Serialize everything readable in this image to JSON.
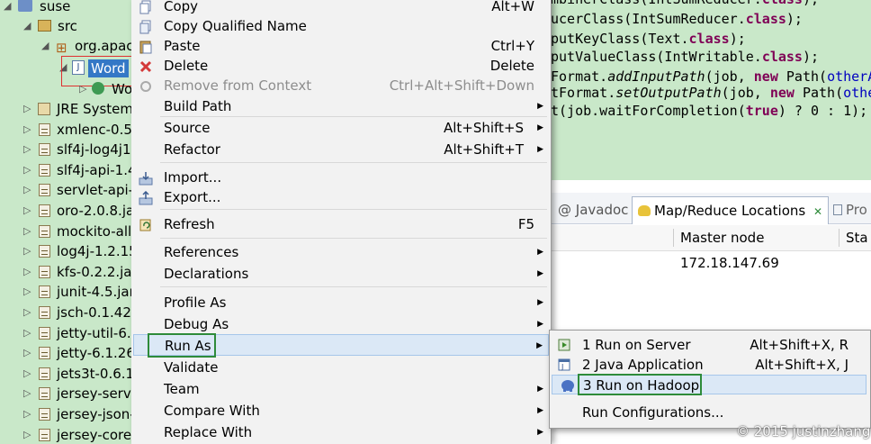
{
  "explorer": {
    "project": "suse",
    "src": "src",
    "package": "org.apac",
    "selected_file": "Word",
    "child_class": "Wo",
    "libraries": [
      "JRE System",
      "xmlenc-0.5.",
      "slf4j-log4j1",
      "slf4j-api-1.4",
      "servlet-api-",
      "oro-2.0.8.ja",
      "mockito-all",
      "log4j-1.2.15",
      "kfs-0.2.2.jar",
      "junit-4.5.jar",
      "jsch-0.1.42.",
      "jetty-util-6.",
      "jetty-6.1.26",
      "jets3t-0.6.1",
      "jersey-serve",
      "jersey-json-",
      "jersey-core"
    ]
  },
  "editor": {
    "lines": [
      {
        "pre": "mbinerClass(IntSumReducer.",
        "kw": "class",
        "post": ");"
      },
      {
        "pre": "ucerClass(IntSumReducer.",
        "kw": "class",
        "post": ");"
      },
      {
        "pre": "putKeyClass(Text.",
        "kw": "class",
        "post": ");"
      },
      {
        "pre": "putValueClass(IntWritable.",
        "kw": "class",
        "post": ");"
      },
      {
        "pre": "Format.",
        "it": "addInputPath",
        "mid": "(job, ",
        "kw2": "new",
        "post": " Path(",
        "fld": "otherA"
      },
      {
        "pre": "tFormat.",
        "it": "setOutputPath",
        "mid": "(job, ",
        "kw2": "new",
        "post": " Path(",
        "fld": "othe"
      },
      {
        "pre": "t(job.waitForCompletion(",
        "kw": "true",
        "post": ") ? 0 : 1);"
      }
    ]
  },
  "views": {
    "tab_javadoc": "@ Javadoc",
    "tab_mapreduce": "Map/Reduce Locations",
    "tab_close": "✕",
    "tab_pro": "Pro",
    "col_master": "Master node",
    "col_sta": "Sta",
    "row_master": "172.18.147.69"
  },
  "menu": {
    "copy": "Copy",
    "copy_sc": "Alt+W",
    "copy_qualified": "Copy Qualified Name",
    "paste": "Paste",
    "paste_sc": "Ctrl+Y",
    "delete": "Delete",
    "delete_sc": "Delete",
    "remove_context": "Remove from Context",
    "remove_context_sc": "Ctrl+Alt+Shift+Down",
    "build_path": "Build Path",
    "source": "Source",
    "source_sc": "Alt+Shift+S",
    "refactor": "Refactor",
    "refactor_sc": "Alt+Shift+T",
    "import": "Import...",
    "export": "Export...",
    "refresh": "Refresh",
    "refresh_sc": "F5",
    "references": "References",
    "declarations": "Declarations",
    "profile_as": "Profile As",
    "debug_as": "Debug As",
    "run_as": "Run As",
    "validate": "Validate",
    "team": "Team",
    "compare_with": "Compare With",
    "replace_with": "Replace With"
  },
  "submenu": {
    "run_server": "1 Run on Server",
    "run_server_sc": "Alt+Shift+X, R",
    "java_app": "2 Java Application",
    "java_app_sc": "Alt+Shift+X, J",
    "run_hadoop": "3 Run on Hadoop",
    "run_configs": "Run Configurations..."
  },
  "watermark": "© 2015 justinzhang",
  "colors": {
    "green_bg": "#c9e8c9",
    "highlight": "#dbe8f6",
    "annotation_green": "#2e8b3a",
    "annotation_red": "#e03030"
  }
}
